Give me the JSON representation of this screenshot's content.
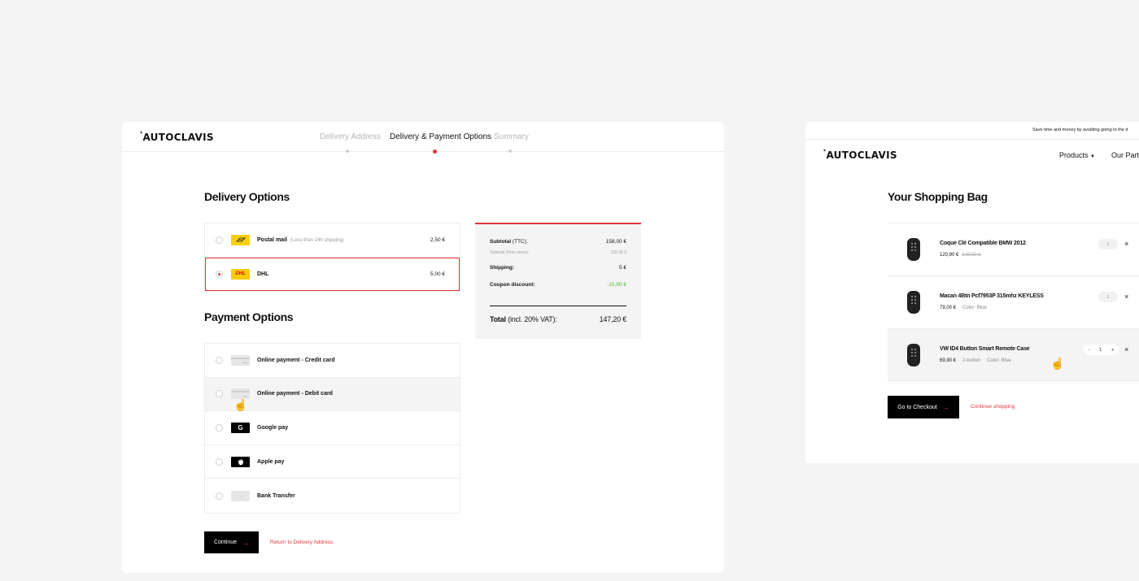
{
  "left": {
    "logo": "AUTOCLAVIS",
    "logo_mark": "*",
    "steps": [
      "Delivery Address",
      "Delivery & Payment Options",
      "Summary"
    ],
    "active_step": 1,
    "delivery_title": "Delivery Options",
    "delivery_options": [
      {
        "name": "Postal mail",
        "note": "(Less than 24h shipping)",
        "price": "2,50 €",
        "selected": false,
        "icon": "postal-icon"
      },
      {
        "name": "DHL",
        "note": "",
        "price": "5,00 €",
        "selected": true,
        "icon": "dhl-icon"
      }
    ],
    "payment_title": "Payment Options",
    "payment_options": [
      {
        "name": "Online payment - Credit card",
        "icon": "credit-card-icon"
      },
      {
        "name": "Online payment - Debit card",
        "icon": "debit-card-icon"
      },
      {
        "name": "Google pay",
        "icon": "google-pay-icon"
      },
      {
        "name": "Apple pay",
        "icon": "apple-pay-icon"
      },
      {
        "name": "Bank Transfer",
        "icon": "bank-transfer-icon"
      }
    ],
    "continue_label": "Continue",
    "return_label": "Return to Delivery Address",
    "summary": {
      "subtotal_label": "Subtotal",
      "subtotal_suffix": "(TTC):",
      "subtotal_value": "158,00 €",
      "subtotal_ht_label": "Subtotal (Hors taxes):",
      "subtotal_ht_value": "126,40 €",
      "shipping_label": "Shipping:",
      "shipping_value": "5 €",
      "coupon_label": "Coupon discount:",
      "coupon_value": "-15,80 €",
      "total_label": "Total",
      "total_suffix": "(incl. 20% VAT):",
      "total_value": "147,20 €"
    },
    "badge_text": {
      "dhl": "DHL"
    }
  },
  "right": {
    "banner": "Save time and money by avoiding going to the d",
    "logo": "AUTOCLAVIS",
    "logo_mark": "*",
    "nav": [
      "Products",
      "Our Part"
    ],
    "bag_title": "Your Shopping Bag",
    "items": [
      {
        "name": "Coque Clé Compatible BMW 2012",
        "price": "120,90 €",
        "old_price": "149,90 €",
        "variant": "",
        "color": "",
        "qty": "1"
      },
      {
        "name": "Macan 4Btn Pcf7953P 315mhz KEYLESS",
        "price": "79,00 €",
        "old_price": "",
        "variant": "",
        "color": "Color: Blue",
        "qty": "1"
      },
      {
        "name": "VW ID4 Button Smart Remote Case",
        "price": "69,90 €",
        "old_price": "",
        "variant": "2-button",
        "color": "Color: Blue",
        "qty": "1"
      }
    ],
    "qty_minus": "-",
    "qty_plus": "+",
    "checkout_label": "Go to Checkout",
    "continue_shopping_label": "Continue shopping"
  },
  "colors": {
    "accent": "#e0363b",
    "discount": "#53b63a",
    "background": "#f4f4f4"
  }
}
